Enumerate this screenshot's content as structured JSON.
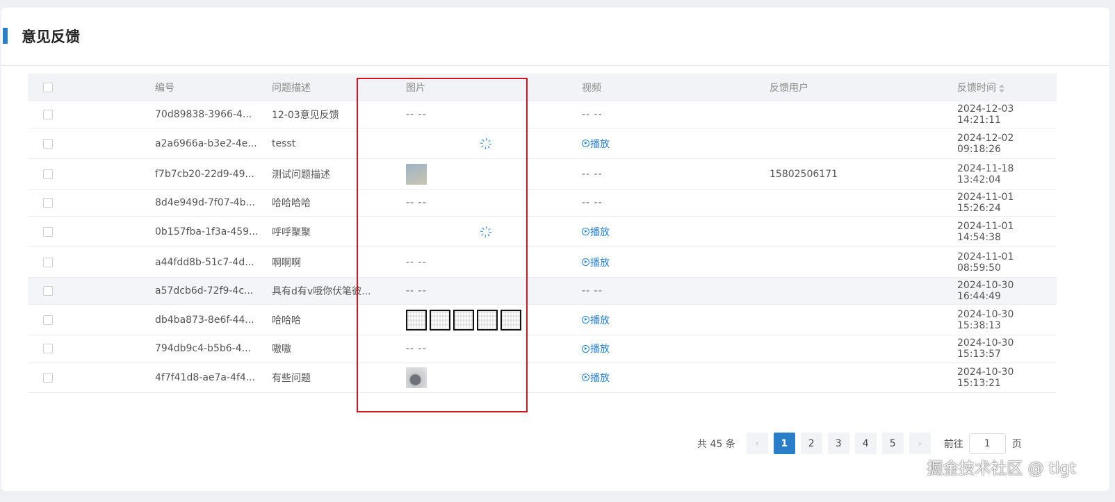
{
  "page": {
    "title": "意见反馈"
  },
  "table": {
    "columns": [
      "编号",
      "问题描述",
      "图片",
      "视频",
      "反馈用户",
      "反馈时间"
    ],
    "rows": [
      {
        "id": "70d89838-3966-4...",
        "desc": "12-03意见反馈",
        "image": "-- --",
        "video": "-- --",
        "user": "",
        "time": "2024-12-03 14:21:11"
      },
      {
        "id": "a2a6966a-b3e2-4e...",
        "desc": "tesst",
        "image": "loading",
        "video": "播放",
        "user": "",
        "time": "2024-12-02 09:18:26"
      },
      {
        "id": "f7b7cb20-22d9-49...",
        "desc": "测试问题描述",
        "image": "thumb-sky",
        "video": "-- --",
        "user": "15802506171",
        "time": "2024-11-18 13:42:04"
      },
      {
        "id": "8d4e949d-7f07-4b...",
        "desc": "哈哈哈哈",
        "image": "-- --",
        "video": "-- --",
        "user": "",
        "time": "2024-11-01 15:26:24"
      },
      {
        "id": "0b157fba-1f3a-459...",
        "desc": "呼呼聚聚",
        "image": "loading",
        "video": "播放",
        "user": "",
        "time": "2024-11-01 14:54:38"
      },
      {
        "id": "a44fdd8b-51c7-4d...",
        "desc": "啊啊啊",
        "image": "-- --",
        "video": "播放",
        "user": "",
        "time": "2024-11-01 08:59:50"
      },
      {
        "id": "a57dcb6d-72f9-4c...",
        "desc": "具有d有v哦你伏笔彼...",
        "image": "-- --",
        "video": "-- --",
        "user": "",
        "time": "2024-10-30 16:44:49"
      },
      {
        "id": "db4ba873-8e6f-44...",
        "desc": "哈哈哈",
        "image": "qr-codes",
        "video": "播放",
        "user": "",
        "time": "2024-10-30 15:38:13"
      },
      {
        "id": "794db9c4-b5b6-4...",
        "desc": "嗷嗷",
        "image": "-- --",
        "video": "播放",
        "user": "",
        "time": "2024-10-30 15:13:57"
      },
      {
        "id": "4f7f41d8-ae7a-4f4...",
        "desc": "有些问题",
        "image": "thumb-device",
        "video": "播放",
        "user": "",
        "time": "2024-10-30 15:13:21"
      }
    ]
  },
  "pagination": {
    "total_text": "共 45 条",
    "pages": [
      "1",
      "2",
      "3",
      "4",
      "5"
    ],
    "current": "1",
    "prev_icon": "‹",
    "next_icon": "›",
    "goto_label": "前往",
    "goto_value": "1",
    "page_suffix": "页"
  },
  "watermark": "掘金技术社区 @ tlgt",
  "colors": {
    "accent": "#2a7ec7",
    "highlight_box": "#d0161f"
  }
}
